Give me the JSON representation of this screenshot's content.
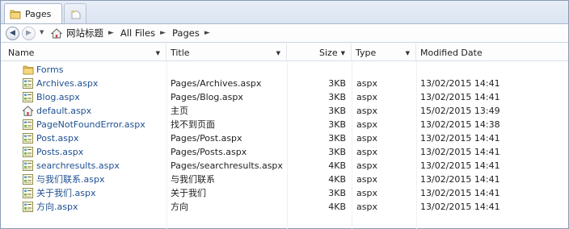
{
  "tab": {
    "label": "Pages"
  },
  "breadcrumb": {
    "items": [
      "网站标题",
      "All Files",
      "Pages"
    ]
  },
  "columns": {
    "name": "Name",
    "title": "Title",
    "size": "Size",
    "type": "Type",
    "modified": "Modified Date"
  },
  "rows": [
    {
      "name": "Forms",
      "icon": "folder-icon",
      "title": "",
      "size": "",
      "type": "",
      "modified": ""
    },
    {
      "name": "Archives.aspx",
      "icon": "aspx-page-icon",
      "title": "Pages/Archives.aspx",
      "size": "3KB",
      "type": "aspx",
      "modified": "13/02/2015 14:41"
    },
    {
      "name": "Blog.aspx",
      "icon": "aspx-page-icon",
      "title": "Pages/Blog.aspx",
      "size": "3KB",
      "type": "aspx",
      "modified": "13/02/2015 14:41"
    },
    {
      "name": "default.aspx",
      "icon": "home-page-icon",
      "title": "主页",
      "size": "3KB",
      "type": "aspx",
      "modified": "15/02/2015 13:49"
    },
    {
      "name": "PageNotFoundError.aspx",
      "icon": "aspx-page-icon",
      "title": "找不到页面",
      "size": "3KB",
      "type": "aspx",
      "modified": "13/02/2015 14:38"
    },
    {
      "name": "Post.aspx",
      "icon": "aspx-page-icon",
      "title": "Pages/Post.aspx",
      "size": "3KB",
      "type": "aspx",
      "modified": "13/02/2015 14:41"
    },
    {
      "name": "Posts.aspx",
      "icon": "aspx-page-icon",
      "title": "Pages/Posts.aspx",
      "size": "3KB",
      "type": "aspx",
      "modified": "13/02/2015 14:41"
    },
    {
      "name": "searchresults.aspx",
      "icon": "aspx-page-icon",
      "title": "Pages/searchresults.aspx",
      "size": "4KB",
      "type": "aspx",
      "modified": "13/02/2015 14:41"
    },
    {
      "name": "与我们联系.aspx",
      "icon": "aspx-page-icon",
      "title": "与我们联系",
      "size": "4KB",
      "type": "aspx",
      "modified": "13/02/2015 14:41"
    },
    {
      "name": "关于我们.aspx",
      "icon": "aspx-page-icon",
      "title": "关于我们",
      "size": "3KB",
      "type": "aspx",
      "modified": "13/02/2015 14:41"
    },
    {
      "name": "方向.aspx",
      "icon": "aspx-page-icon",
      "title": "方向",
      "size": "4KB",
      "type": "aspx",
      "modified": "13/02/2015 14:41"
    }
  ]
}
